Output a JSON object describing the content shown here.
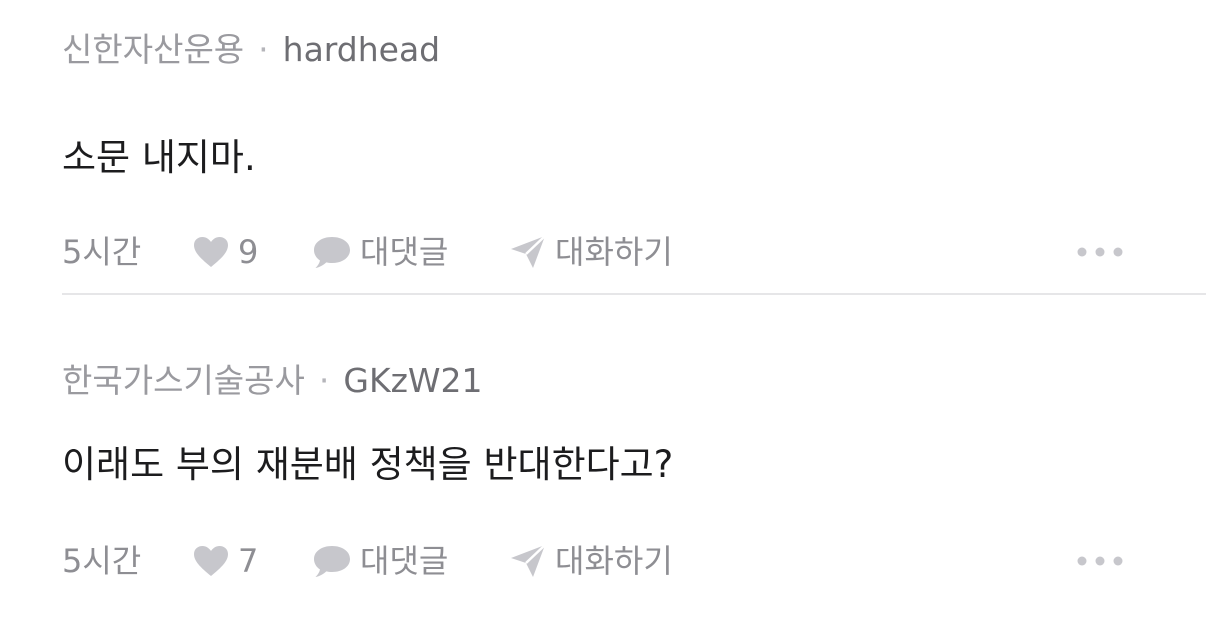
{
  "comments": [
    {
      "company": "신한자산운용",
      "separator": "·",
      "user": "hardhead",
      "text": "소문 내지마.",
      "time": "5시간",
      "likes": "9",
      "reply_label": "대댓글",
      "chat_label": "대화하기"
    },
    {
      "company": "한국가스기술공사",
      "separator": "·",
      "user": "GKzW21",
      "text": "이래도 부의 재분배 정책을 반대한다고?",
      "time": "5시간",
      "likes": "7",
      "reply_label": "대댓글",
      "chat_label": "대화하기"
    }
  ],
  "icons": {
    "like": "heart-icon",
    "reply": "speech-bubble-icon",
    "chat": "paper-plane-icon",
    "more": "more-dots-icon"
  },
  "colors": {
    "text": "#1c1c1e",
    "meta": "#8e8e93",
    "icon": "#c7c7cc",
    "divider": "#e6e6e8"
  }
}
